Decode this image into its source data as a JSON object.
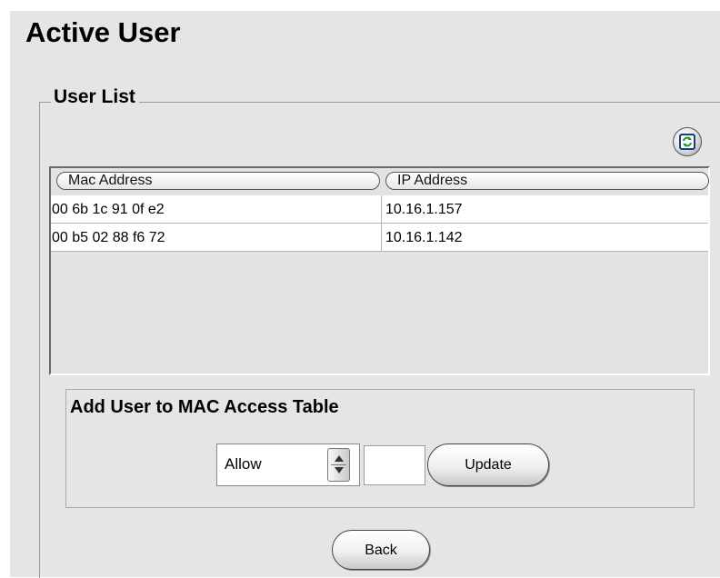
{
  "page": {
    "title": "Active User"
  },
  "user_list": {
    "legend": "User List",
    "refresh_icon": "refresh-icon",
    "columns": [
      "Mac Address",
      "IP Address"
    ],
    "rows": [
      {
        "mac": "00 6b 1c 91 0f e2",
        "ip": "10.16.1.157"
      },
      {
        "mac": "00 b5 02 88 f6 72",
        "ip": "10.16.1.142"
      }
    ]
  },
  "mac_access": {
    "title": "Add User to MAC Access Table",
    "action_select": "Allow",
    "index_value": "",
    "update_label": "Update"
  },
  "footer": {
    "back_label": "Back"
  }
}
